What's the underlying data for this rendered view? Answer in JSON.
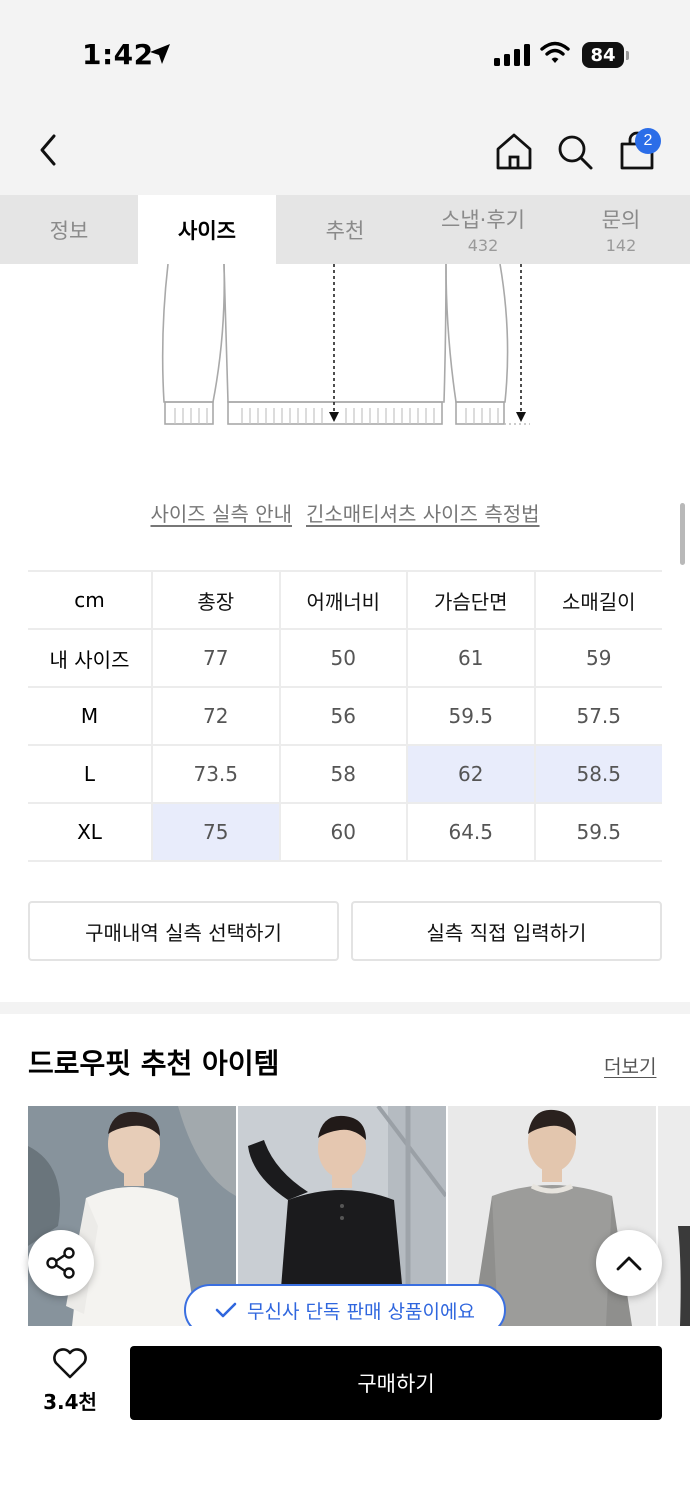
{
  "status_bar": {
    "time": "1:42",
    "battery": "84"
  },
  "header": {
    "cart_count": "2"
  },
  "tabs": [
    {
      "label": "정보",
      "sub": ""
    },
    {
      "label": "사이즈",
      "sub": ""
    },
    {
      "label": "추천",
      "sub": ""
    },
    {
      "label": "스냅·후기",
      "sub": "432"
    },
    {
      "label": "문의",
      "sub": "142"
    }
  ],
  "active_tab": "사이즈",
  "size_links": {
    "guide": "사이즈 실측 안내",
    "method": "긴소매티셔츠 사이즈 측정법"
  },
  "size_table": {
    "unit": "cm",
    "columns": [
      "총장",
      "어깨너비",
      "가슴단면",
      "소매길이"
    ],
    "rows": [
      {
        "label": "내 사이즈",
        "values": [
          "77",
          "50",
          "61",
          "59"
        ]
      },
      {
        "label": "M",
        "values": [
          "72",
          "56",
          "59.5",
          "57.5"
        ]
      },
      {
        "label": "L",
        "values": [
          "73.5",
          "58",
          "62",
          "58.5"
        ]
      },
      {
        "label": "XL",
        "values": [
          "75",
          "60",
          "64.5",
          "59.5"
        ]
      }
    ]
  },
  "actions": {
    "select_purchase": "구매내역 실측 선택하기",
    "direct_input": "실측 직접 입력하기"
  },
  "recommend": {
    "title": "드로우핏 추천 아이템",
    "more": "더보기"
  },
  "exclusive_badge": "무신사 단독 판매 상품이에요",
  "bottom": {
    "like_count": "3.4천",
    "buy_label": "구매하기"
  },
  "colors": {
    "accent_blue": "#2b6de8",
    "highlight": "#e8ecfb"
  }
}
